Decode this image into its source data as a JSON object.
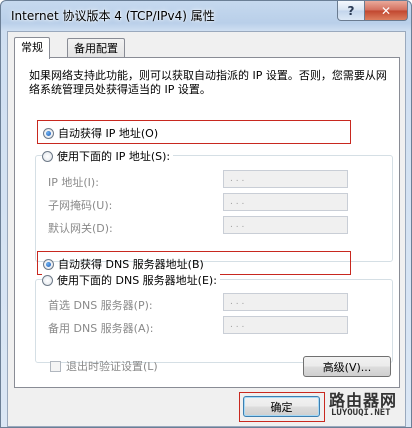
{
  "window": {
    "title": "Internet 协议版本 4 (TCP/IPv4) 属性",
    "help_glyph": "?",
    "close_glyph": "✕"
  },
  "tabs": [
    {
      "label": "常规",
      "active": true
    },
    {
      "label": "备用配置",
      "active": false
    }
  ],
  "description": "如果网络支持此功能，则可以获取自动指派的 IP 设置。否则，您需要从网络系统管理员处获得适当的 IP 设置。",
  "ip_mode": {
    "auto_label": "自动获得 IP 地址(O)",
    "manual_label": "使用下面的 IP 地址(S):",
    "selected": "auto",
    "fields": [
      {
        "label": "IP 地址(I):",
        "value": ". . ."
      },
      {
        "label": "子网掩码(U):",
        "value": ". . ."
      },
      {
        "label": "默认网关(D):",
        "value": ". . ."
      }
    ]
  },
  "dns_mode": {
    "auto_label": "自动获得 DNS 服务器地址(B)",
    "manual_label": "使用下面的 DNS 服务器地址(E):",
    "selected": "auto",
    "fields": [
      {
        "label": "首选 DNS 服务器(P):",
        "value": ". . ."
      },
      {
        "label": "备用 DNS 服务器(A):",
        "value": ". . ."
      }
    ]
  },
  "validate_on_exit": {
    "label": "退出时验证设置(L)",
    "checked": false
  },
  "advanced_button": "高级(V)...",
  "ok_button": "确定",
  "watermark": {
    "line1": "路由器网",
    "line2": "LUYOUQI.NET"
  },
  "colors": {
    "highlight": "#c8281f",
    "accent": "#1b58b8"
  }
}
